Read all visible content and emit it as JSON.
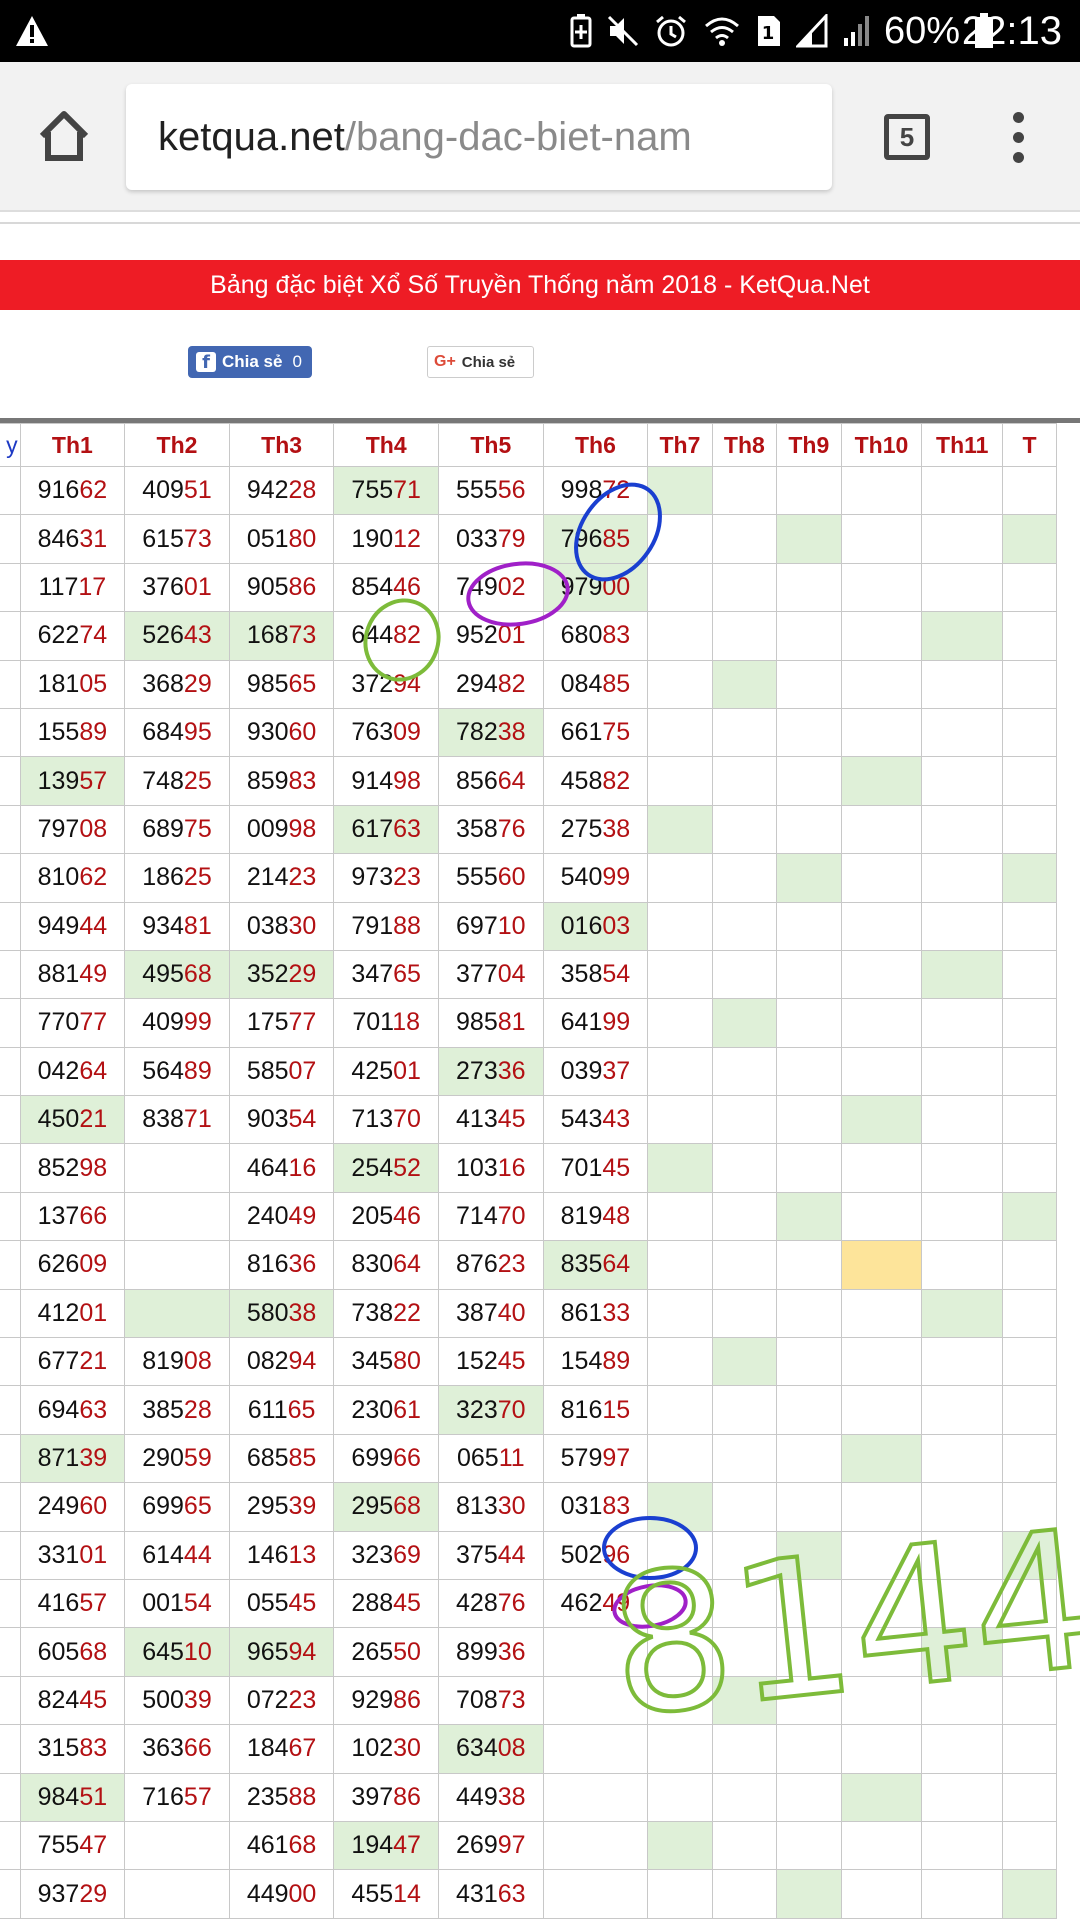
{
  "status_bar": {
    "battery_percent": "60%",
    "time": "22:13",
    "sim_slot": "1",
    "icons": [
      "warning-icon",
      "battery-saver-icon",
      "mute-icon",
      "alarm-icon",
      "wifi-icon",
      "sim-icon",
      "signal-icon",
      "signal-icon",
      "battery-icon"
    ]
  },
  "browser": {
    "url_host": "ketqua.net",
    "url_path": "/bang-dac-biet-nam",
    "tab_count": "5"
  },
  "banner": {
    "title": "Bảng đặc biệt Xổ Số Truyền Thống năm 2018 - KetQua.Net"
  },
  "share": {
    "facebook_label": "Chia sẻ",
    "facebook_count": "0",
    "google_label": "Chia sẻ",
    "google_icon_text": "G+"
  },
  "table": {
    "day_header": "y",
    "headers": [
      "Th1",
      "Th2",
      "Th3",
      "Th4",
      "Th5",
      "Th6",
      "Th7",
      "Th8",
      "Th9",
      "Th10",
      "Th11",
      "T"
    ],
    "rows": [
      [
        "91662",
        "40951",
        "94228",
        "75571",
        "55556",
        "99872",
        "",
        "",
        "",
        "",
        "",
        ""
      ],
      [
        "84631",
        "61573",
        "05180",
        "19012",
        "03379",
        "79685",
        "",
        "",
        "",
        "",
        "",
        ""
      ],
      [
        "11717",
        "37601",
        "90586",
        "85446",
        "74902",
        "97900",
        "",
        "",
        "",
        "",
        "",
        ""
      ],
      [
        "62274",
        "52643",
        "16873",
        "64482",
        "95201",
        "68083",
        "",
        "",
        "",
        "",
        "",
        ""
      ],
      [
        "18105",
        "36829",
        "98565",
        "37294",
        "29482",
        "08485",
        "",
        "",
        "",
        "",
        "",
        ""
      ],
      [
        "15589",
        "68495",
        "93060",
        "76309",
        "78238",
        "66175",
        "",
        "",
        "",
        "",
        "",
        ""
      ],
      [
        "13957",
        "74825",
        "85983",
        "91498",
        "85664",
        "45882",
        "",
        "",
        "",
        "",
        "",
        ""
      ],
      [
        "79708",
        "68975",
        "00998",
        "61763",
        "35876",
        "27538",
        "",
        "",
        "",
        "",
        "",
        ""
      ],
      [
        "81062",
        "18625",
        "21423",
        "97323",
        "55560",
        "54099",
        "",
        "",
        "",
        "",
        "",
        ""
      ],
      [
        "94944",
        "93481",
        "03830",
        "79188",
        "69710",
        "01603",
        "",
        "",
        "",
        "",
        "",
        ""
      ],
      [
        "88149",
        "49568",
        "35229",
        "34765",
        "37704",
        "35854",
        "",
        "",
        "",
        "",
        "",
        ""
      ],
      [
        "77077",
        "40999",
        "17577",
        "70118",
        "98581",
        "64199",
        "",
        "",
        "",
        "",
        "",
        ""
      ],
      [
        "04264",
        "56489",
        "58507",
        "42501",
        "27336",
        "03937",
        "",
        "",
        "",
        "",
        "",
        ""
      ],
      [
        "45021",
        "83871",
        "90354",
        "71370",
        "41345",
        "54343",
        "",
        "",
        "",
        "",
        "",
        ""
      ],
      [
        "85298",
        "",
        "46416",
        "25452",
        "10316",
        "70145",
        "",
        "",
        "",
        "",
        "",
        ""
      ],
      [
        "13766",
        "",
        "24049",
        "20546",
        "71470",
        "81948",
        "",
        "",
        "",
        "",
        "",
        ""
      ],
      [
        "62609",
        "",
        "81636",
        "83064",
        "87623",
        "83564",
        "",
        "",
        "",
        "",
        "",
        ""
      ],
      [
        "41201",
        "",
        "58038",
        "73822",
        "38740",
        "86133",
        "",
        "",
        "",
        "",
        "",
        ""
      ],
      [
        "67721",
        "81908",
        "08294",
        "34580",
        "15245",
        "15489",
        "",
        "",
        "",
        "",
        "",
        ""
      ],
      [
        "69463",
        "38528",
        "61165",
        "23061",
        "32370",
        "81615",
        "",
        "",
        "",
        "",
        "",
        ""
      ],
      [
        "87139",
        "29059",
        "68585",
        "69966",
        "06511",
        "57997",
        "",
        "",
        "",
        "",
        "",
        ""
      ],
      [
        "24960",
        "69965",
        "29539",
        "29568",
        "81330",
        "03183",
        "",
        "",
        "",
        "",
        "",
        ""
      ],
      [
        "33101",
        "61444",
        "14613",
        "32369",
        "37544",
        "50296",
        "",
        "",
        "",
        "",
        "",
        ""
      ],
      [
        "41657",
        "00154",
        "05545",
        "28845",
        "42876",
        "46249",
        "",
        "",
        "",
        "",
        "",
        ""
      ],
      [
        "60568",
        "64510",
        "96594",
        "26550",
        "89936",
        "",
        "",
        "",
        "",
        "",
        "",
        ""
      ],
      [
        "82445",
        "50039",
        "07223",
        "92986",
        "70873",
        "",
        "",
        "",
        "",
        "",
        "",
        ""
      ],
      [
        "31583",
        "36366",
        "18467",
        "10230",
        "63408",
        "",
        "",
        "",
        "",
        "",
        "",
        ""
      ],
      [
        "98451",
        "71657",
        "23588",
        "39786",
        "44938",
        "",
        "",
        "",
        "",
        "",
        "",
        ""
      ],
      [
        "75547",
        "",
        "46168",
        "19447",
        "26997",
        "",
        "",
        "",
        "",
        "",
        "",
        ""
      ],
      [
        "93729",
        "",
        "44900",
        "45514",
        "43163",
        "",
        "",
        "",
        "",
        "",
        "",
        ""
      ]
    ],
    "highlight_color": "#dff0d8",
    "special_highlight_color": "#fde49a",
    "number_color": "#b31013"
  },
  "annotation": {
    "handwritten_text": "8144",
    "ink_colors": [
      "#1a3fd0",
      "#a020c8",
      "#7dbb3a"
    ]
  }
}
